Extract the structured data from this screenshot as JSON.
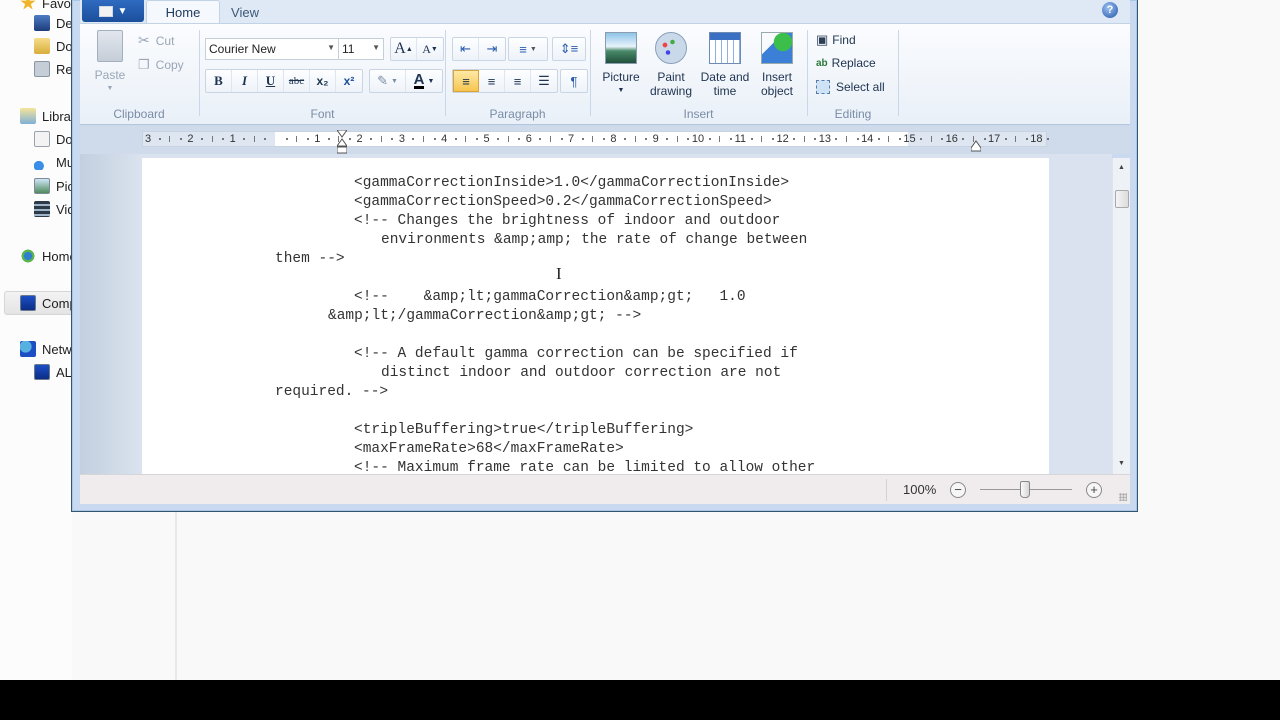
{
  "explorer_nav": {
    "items": [
      {
        "label": "Favorites",
        "icon": "star-icon",
        "level": 0
      },
      {
        "label": "Desktop",
        "icon": "desktop-icon",
        "level": 1
      },
      {
        "label": "Downloads",
        "icon": "downloads-folder-icon",
        "level": 1
      },
      {
        "label": "Recent Places",
        "icon": "recent-places-icon",
        "level": 1
      },
      {
        "label": "Libraries",
        "icon": "libraries-icon",
        "level": 0
      },
      {
        "label": "Documents",
        "icon": "documents-icon",
        "level": 1
      },
      {
        "label": "Music",
        "icon": "music-icon",
        "level": 1
      },
      {
        "label": "Pictures",
        "icon": "pictures-icon",
        "level": 1
      },
      {
        "label": "Videos",
        "icon": "videos-icon",
        "level": 1
      },
      {
        "label": "Homegroup",
        "icon": "homegroup-icon",
        "level": 0
      },
      {
        "label": "Computer",
        "icon": "computer-icon",
        "level": 0,
        "selected": true
      },
      {
        "label": "Network",
        "icon": "network-icon",
        "level": 0
      },
      {
        "label": "AL",
        "icon": "network-computer-icon",
        "level": 1
      }
    ]
  },
  "ribbon": {
    "tabs": [
      {
        "label": "Home",
        "active": true
      },
      {
        "label": "View",
        "active": false
      }
    ],
    "clipboard": {
      "label": "Clipboard",
      "paste": "Paste",
      "cut": "Cut",
      "copy": "Copy"
    },
    "font": {
      "label": "Font",
      "family": "Courier New",
      "size": "11",
      "grow_icon": "A",
      "shrink_icon": "A",
      "bold": "B",
      "italic": "I",
      "underline": "U",
      "strikethrough": "abc",
      "subscript": "x₂",
      "superscript": "x²",
      "text_color_glyph": "A",
      "text_color": "#000000",
      "highlight_color": "#ffffff"
    },
    "paragraph": {
      "label": "Paragraph",
      "alignment": "left"
    },
    "insert": {
      "label": "Insert",
      "picture": "Picture",
      "paint_drawing_1": "Paint",
      "paint_drawing_2": "drawing",
      "date_time_1": "Date and",
      "date_time_2": "time",
      "insert_object_1": "Insert",
      "insert_object_2": "object"
    },
    "editing": {
      "label": "Editing",
      "find": "Find",
      "replace": "Replace",
      "select_all": "Select all"
    }
  },
  "ruler": {
    "left_labels": [
      "3",
      "2",
      "1"
    ],
    "right_labels": [
      "1",
      "2",
      "3",
      "4",
      "5",
      "6",
      "7",
      "8",
      "9",
      "10",
      "11",
      "12",
      "13",
      "14",
      "15",
      "16",
      "17",
      "18"
    ]
  },
  "document": {
    "lines": [
      "<gammaCorrectionInside>1.0</gammaCorrectionInside>",
      "<gammaCorrectionSpeed>0.2</gammaCorrectionSpeed>",
      "<!-- Changes the brightness of indoor and outdoor",
      "environments &amp;amp; the rate of change between",
      "them -->",
      "",
      "<!--    &amp;lt;gammaCorrection&amp;gt;   1.0",
      "&amp;lt;/gammaCorrection&amp;gt; -->",
      "",
      "<!-- A default gamma correction can be specified if",
      "distinct indoor and outdoor correction are not",
      "required. -->",
      "",
      "<tripleBuffering>true</tripleBuffering>",
      "<maxFrameRate>68</maxFrameRate>",
      "<!-- Maximum frame rate can be limited to allow other"
    ]
  },
  "statusbar": {
    "zoom_level": "100%",
    "zoom_percent": 100,
    "zoom_out": "−",
    "zoom_in": "+"
  },
  "help": "?"
}
